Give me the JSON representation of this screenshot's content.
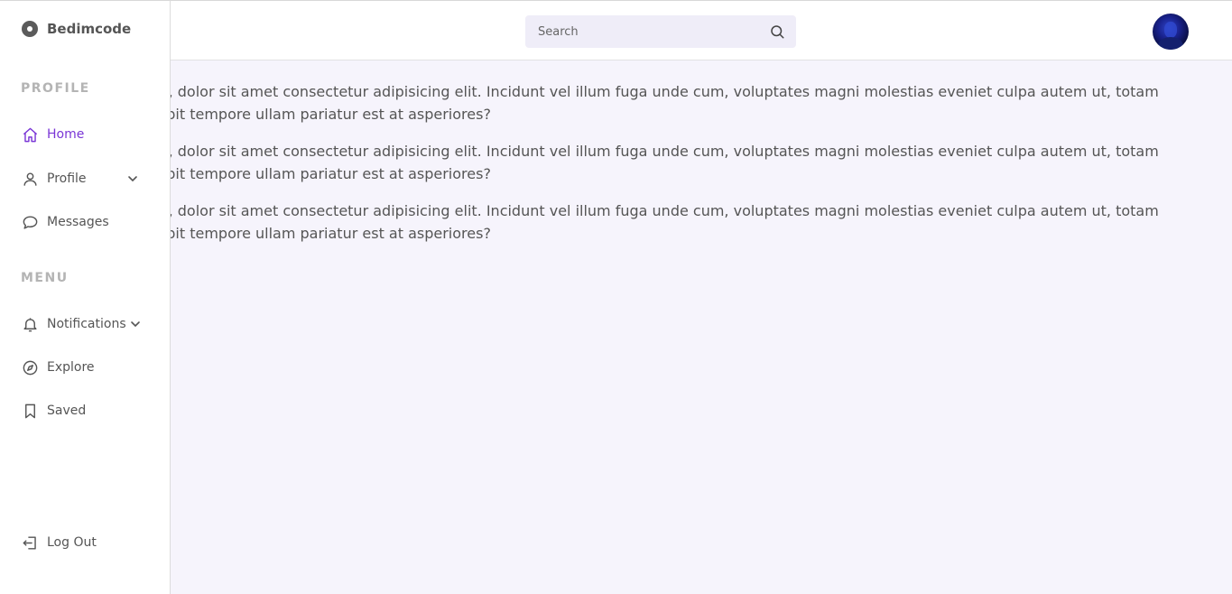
{
  "brand": {
    "name": "Bedimcode"
  },
  "header": {
    "search_placeholder": "Search"
  },
  "sidebar": {
    "section_profile": "PROFILE",
    "section_menu": "MENU",
    "items": [
      {
        "label": "Home",
        "icon": "home-icon",
        "active": true
      },
      {
        "label": "Profile",
        "icon": "user-icon",
        "has_dropdown": true
      },
      {
        "label": "Messages",
        "icon": "message-icon"
      },
      {
        "label": "Notifications",
        "icon": "bell-icon",
        "has_dropdown": true
      },
      {
        "label": "Explore",
        "icon": "compass-icon"
      },
      {
        "label": "Saved",
        "icon": "bookmark-icon"
      }
    ],
    "logout": {
      "label": "Log Out",
      "icon": "logout-icon"
    }
  },
  "content": {
    "paragraphs": [
      "m, dolor sit amet consectetur adipisicing elit. Incidunt vel illum fuga unde cum, voluptates magni molestias eveniet culpa autem ut, totam\ncipit tempore ullam pariatur est at asperiores?",
      "m, dolor sit amet consectetur adipisicing elit. Incidunt vel illum fuga unde cum, voluptates magni molestias eveniet culpa autem ut, totam\ncipit tempore ullam pariatur est at asperiores?",
      "m, dolor sit amet consectetur adipisicing elit. Incidunt vel illum fuga unde cum, voluptates magni molestias eveniet culpa autem ut, totam\ncipit tempore ullam pariatur est at asperiores?"
    ]
  },
  "colors": {
    "accent": "#7a36d6",
    "background": "#f6f4fc",
    "search_bg": "#efedf8"
  }
}
